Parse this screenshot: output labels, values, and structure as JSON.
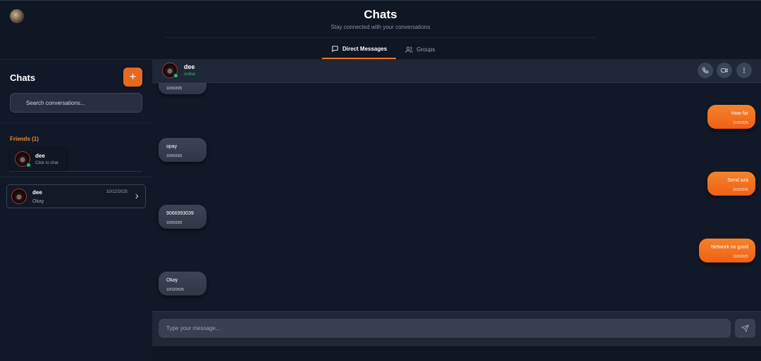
{
  "header": {
    "title": "Chats",
    "subtitle": "Stay connected with your conversations",
    "tabs": [
      {
        "label": "Direct Messages",
        "icon": "message-icon",
        "active": true
      },
      {
        "label": "Groups",
        "icon": "users-icon",
        "active": false
      }
    ]
  },
  "sidebar": {
    "title": "Chats",
    "add_label": "+",
    "search_placeholder": "Search conversations...",
    "friends_label": "Friends (1)",
    "friends": [
      {
        "name": "dee",
        "subtitle": "Click to chat",
        "online": true
      }
    ],
    "conversations": [
      {
        "name": "dee",
        "last_message": "Okay",
        "date": "10/12/2025"
      }
    ]
  },
  "chat": {
    "name": "dee",
    "status": "online",
    "actions": [
      "phone-icon",
      "video-icon",
      "more-vertical-icon"
    ],
    "messages": [
      {
        "direction": "in",
        "text": "",
        "time": "10/9/2025"
      },
      {
        "direction": "out",
        "text": "How far",
        "time": "10/9/2025"
      },
      {
        "direction": "in",
        "text": "opay",
        "time": "10/9/2025"
      },
      {
        "direction": "out",
        "text": "Send aza",
        "time": "10/9/2025"
      },
      {
        "direction": "in",
        "text": "9066993039",
        "time": "10/9/2025"
      },
      {
        "direction": "out",
        "text": "Network no good",
        "time": "10/9/2025"
      },
      {
        "direction": "in",
        "text": "Okay",
        "time": "10/12/2025"
      }
    ],
    "input_placeholder": "Type your message..."
  },
  "colors": {
    "accent": "#f37320",
    "background": "#0f1624",
    "online": "#22c55e"
  }
}
